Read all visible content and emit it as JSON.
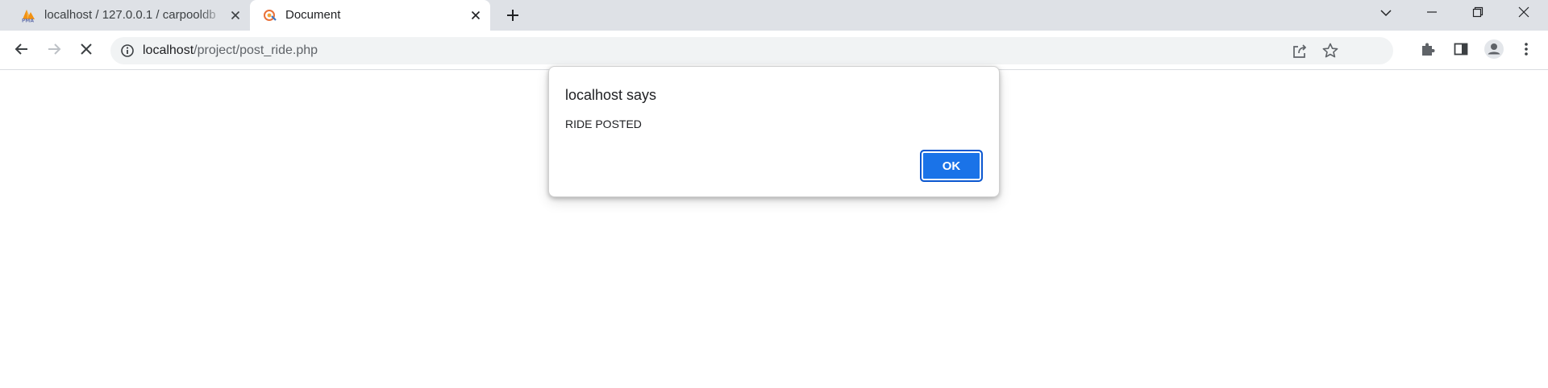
{
  "tabs": [
    {
      "title": "localhost / 127.0.0.1 / carpooldb",
      "favicon": "phpmyadmin-icon",
      "active": false
    },
    {
      "title": "Document",
      "favicon": "page-favicon-icon",
      "active": true
    }
  ],
  "address_bar": {
    "host": "localhost",
    "path": "/project/post_ride.php"
  },
  "dialog": {
    "title": "localhost says",
    "message": "RIDE POSTED",
    "ok_label": "OK"
  },
  "colors": {
    "accent": "#1a73e8",
    "tabstrip_bg": "#dee1e6",
    "omnibox_bg": "#f1f3f4"
  }
}
